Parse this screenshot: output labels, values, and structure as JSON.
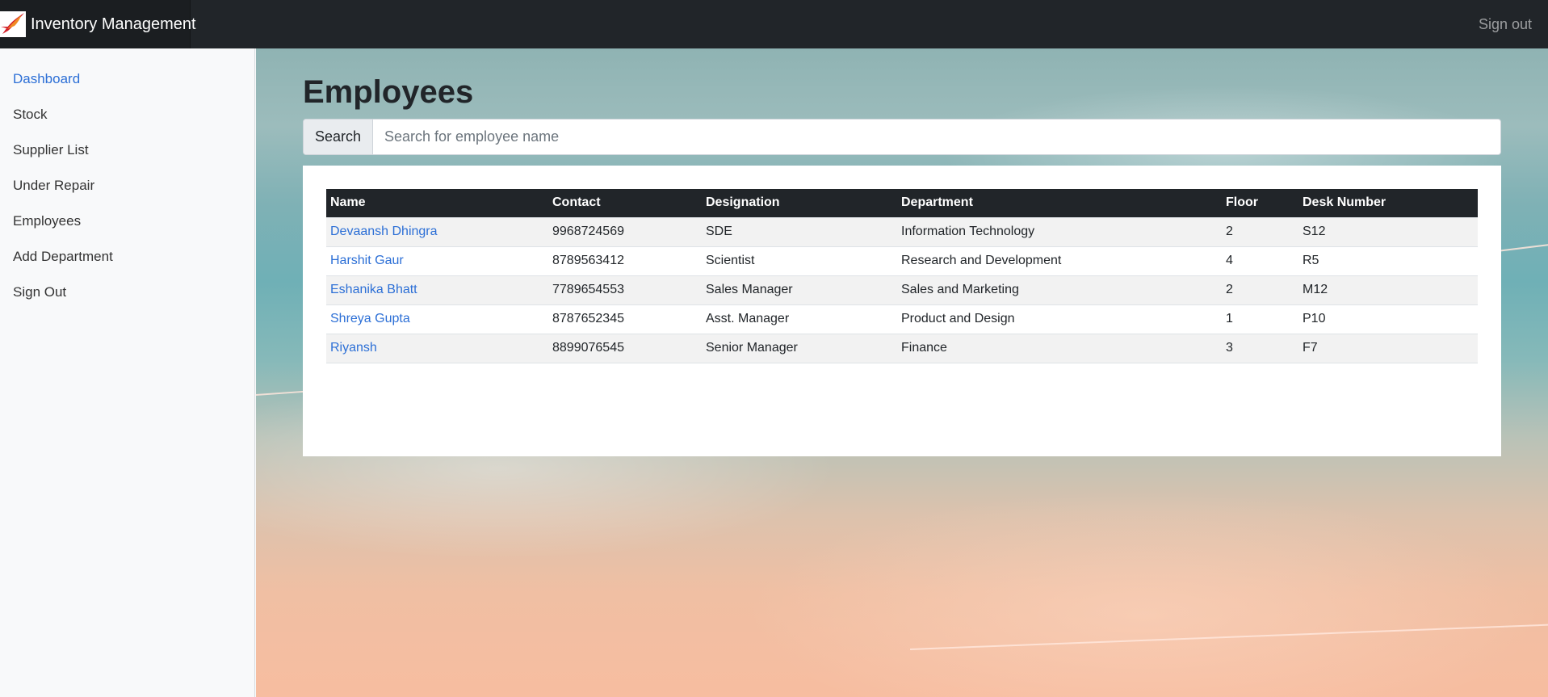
{
  "navbar": {
    "brand_text": "Inventory Management",
    "logo_icon": "airline-bird-logo",
    "signout_label": "Sign out"
  },
  "sidebar": {
    "items": [
      {
        "label": "Dashboard",
        "active": true
      },
      {
        "label": "Stock"
      },
      {
        "label": "Supplier List"
      },
      {
        "label": "Under Repair"
      },
      {
        "label": "Employees"
      },
      {
        "label": "Add Department"
      },
      {
        "label": "Sign Out"
      }
    ]
  },
  "main": {
    "title": "Employees",
    "search": {
      "label": "Search",
      "placeholder": "Search for employee name",
      "value": ""
    },
    "table": {
      "columns": [
        "Name",
        "Contact",
        "Designation",
        "Department",
        "Floor",
        "Desk Number"
      ],
      "rows": [
        {
          "name": "Devaansh Dhingra",
          "contact": "9968724569",
          "designation": "SDE",
          "department": "Information Technology",
          "floor": "2",
          "desk": "S12"
        },
        {
          "name": "Harshit Gaur",
          "contact": "8789563412",
          "designation": "Scientist",
          "department": "Research and Development",
          "floor": "4",
          "desk": "R5"
        },
        {
          "name": "Eshanika Bhatt",
          "contact": "7789654553",
          "designation": "Sales Manager",
          "department": "Sales and Marketing",
          "floor": "2",
          "desk": "M12"
        },
        {
          "name": "Shreya Gupta",
          "contact": "8787652345",
          "designation": "Asst. Manager",
          "department": "Product and Design",
          "floor": "1",
          "desk": "P10"
        },
        {
          "name": "Riyansh",
          "contact": "8899076545",
          "designation": "Senior Manager",
          "department": "Finance",
          "floor": "3",
          "desk": "F7"
        }
      ]
    }
  },
  "colors": {
    "navbar_bg": "#212529",
    "link": "#2c6fd6",
    "logo_red": "#d3202a"
  }
}
